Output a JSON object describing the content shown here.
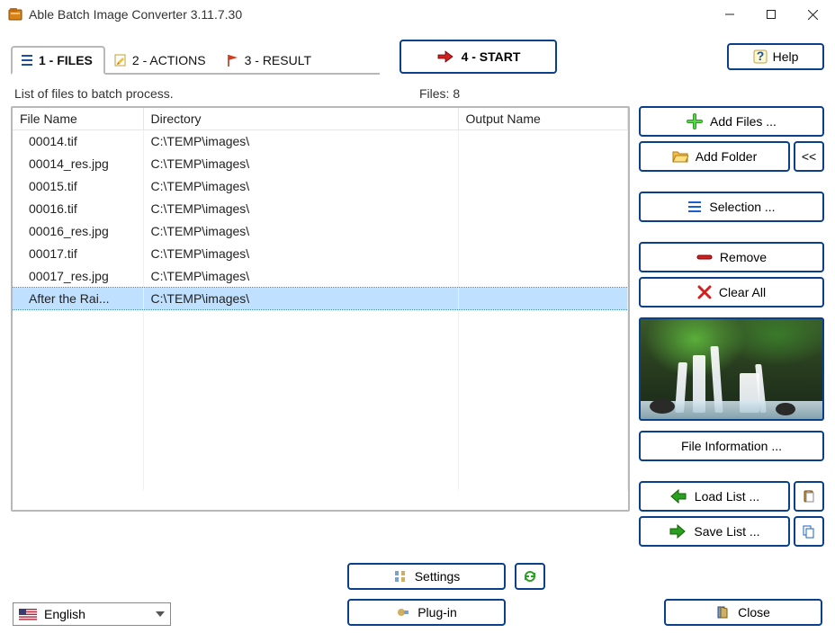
{
  "window": {
    "title": "Able Batch Image Converter 3.11.7.30"
  },
  "tabs": {
    "files": "1 - FILES",
    "actions": "2 - ACTIONS",
    "result": "3 - RESULT"
  },
  "start_label": "4 - START",
  "help_label": "Help",
  "list_header": "List of files to batch process.",
  "files_count_label": "Files: 8",
  "columns": {
    "file": "File Name",
    "dir": "Directory",
    "out": "Output Name"
  },
  "rows": [
    {
      "file": "00014.tif",
      "dir": "C:\\TEMP\\images\\",
      "out": ""
    },
    {
      "file": "00014_res.jpg",
      "dir": "C:\\TEMP\\images\\",
      "out": ""
    },
    {
      "file": "00015.tif",
      "dir": "C:\\TEMP\\images\\",
      "out": ""
    },
    {
      "file": "00016.tif",
      "dir": "C:\\TEMP\\images\\",
      "out": ""
    },
    {
      "file": "00016_res.jpg",
      "dir": "C:\\TEMP\\images\\",
      "out": ""
    },
    {
      "file": "00017.tif",
      "dir": "C:\\TEMP\\images\\",
      "out": ""
    },
    {
      "file": "00017_res.jpg",
      "dir": "C:\\TEMP\\images\\",
      "out": ""
    },
    {
      "file": "After the Rai...",
      "dir": "C:\\TEMP\\images\\",
      "out": ""
    }
  ],
  "selected_row_index": 7,
  "side": {
    "add_files": "Add Files ...",
    "add_folder": "Add Folder",
    "add_folder_more": "<<",
    "selection": "Selection ...",
    "remove": "Remove",
    "clear_all": "Clear All",
    "file_info": "File Information ...",
    "load_list": "Load List ...",
    "save_list": "Save List ..."
  },
  "bottom": {
    "language": "English",
    "settings": "Settings",
    "plugin": "Plug-in",
    "close": "Close"
  }
}
